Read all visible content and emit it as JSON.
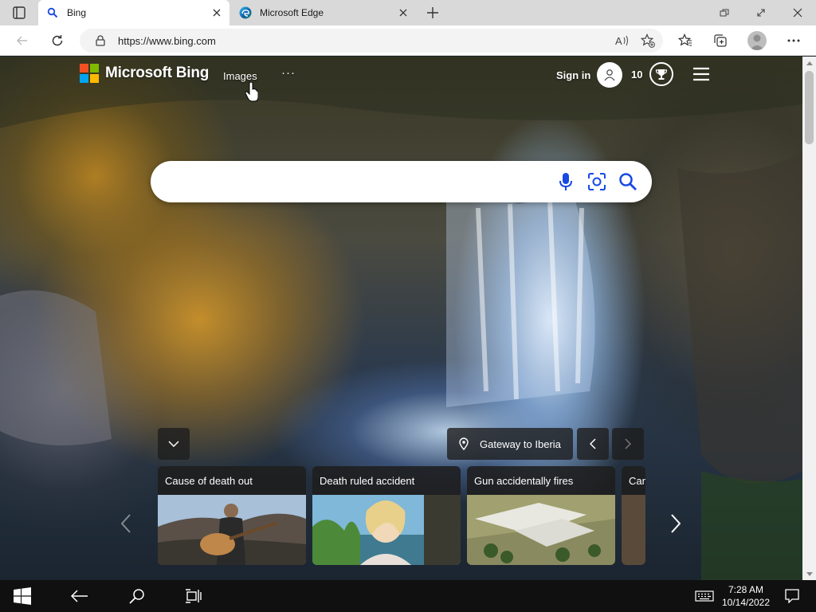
{
  "browser": {
    "tabs": [
      {
        "title": "Bing",
        "active": true
      },
      {
        "title": "Microsoft Edge",
        "active": false
      }
    ],
    "address": {
      "url": "https://www.bing.com"
    }
  },
  "bing": {
    "brand": "Microsoft Bing",
    "nav": {
      "images": "Images",
      "more": "···"
    },
    "signin": "Sign in",
    "points": "10",
    "search": {
      "value": "",
      "placeholder": ""
    },
    "location": "Gateway to Iberia",
    "cards": [
      {
        "title": "Cause of death out"
      },
      {
        "title": "Death ruled accident"
      },
      {
        "title": "Gun accidentally fires"
      },
      {
        "title": "Can"
      }
    ]
  },
  "taskbar": {
    "time": "7:28 AM",
    "date": "10/14/2022"
  },
  "colors": {
    "ms_red": "#f25022",
    "ms_green": "#7fba00",
    "ms_blue": "#00a4ef",
    "ms_yellow": "#ffb900",
    "bing_blue": "#174ae4"
  }
}
